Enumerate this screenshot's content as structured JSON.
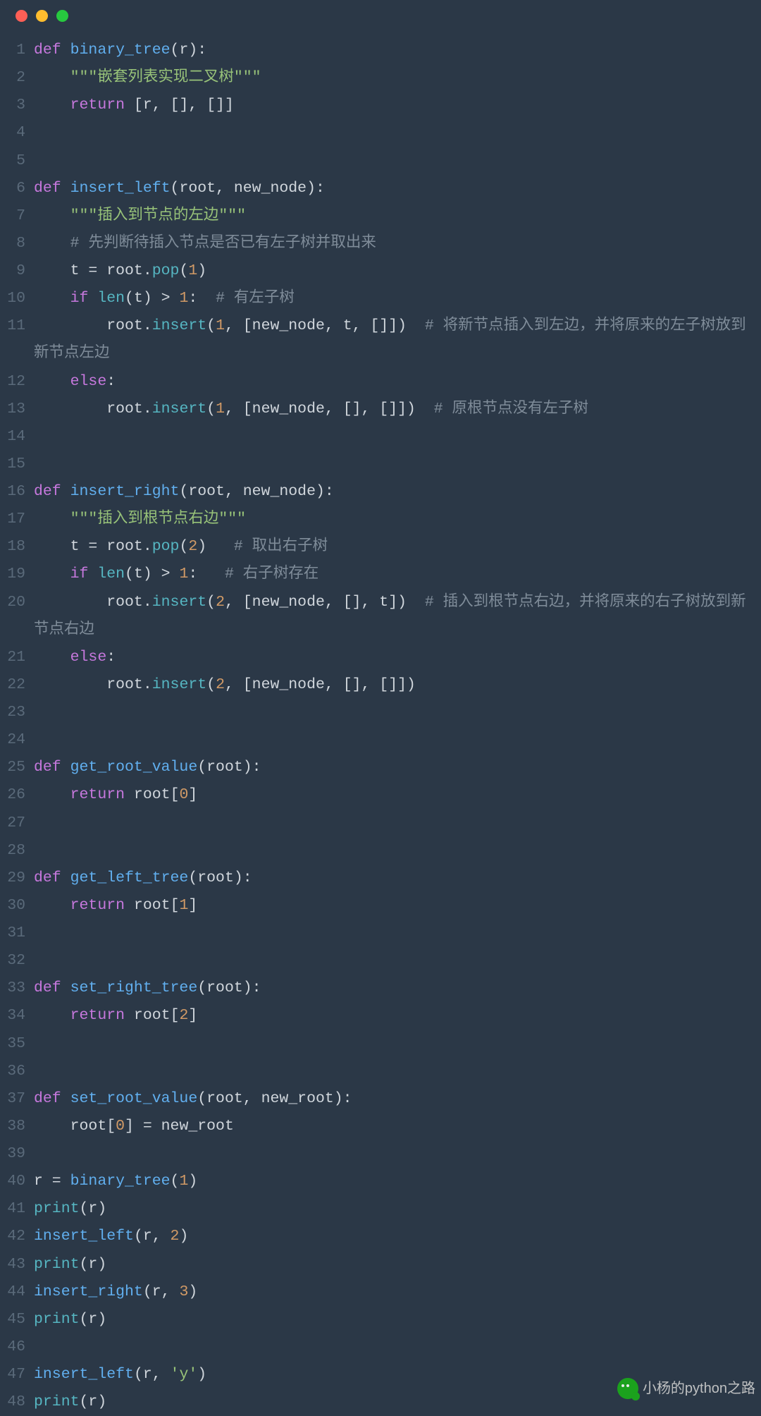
{
  "window": {
    "buttons": [
      "close",
      "minimize",
      "zoom"
    ]
  },
  "watermark": "小杨的python之路",
  "code": {
    "lines": [
      {
        "n": 1,
        "t": [
          [
            "kw",
            "def "
          ],
          [
            "fn",
            "binary_tree"
          ],
          [
            "p",
            "(r):"
          ]
        ]
      },
      {
        "n": 2,
        "t": [
          [
            "p",
            "    "
          ],
          [
            "s",
            "\"\"\"嵌套列表实现二叉树\"\"\""
          ]
        ]
      },
      {
        "n": 3,
        "t": [
          [
            "p",
            "    "
          ],
          [
            "kw",
            "return"
          ],
          [
            "p",
            " [r, [], []]"
          ]
        ]
      },
      {
        "n": 4,
        "t": [
          [
            "p",
            ""
          ]
        ]
      },
      {
        "n": 5,
        "t": [
          [
            "p",
            ""
          ]
        ]
      },
      {
        "n": 6,
        "t": [
          [
            "kw",
            "def "
          ],
          [
            "fn",
            "insert_left"
          ],
          [
            "p",
            "(root, new_node):"
          ]
        ]
      },
      {
        "n": 7,
        "t": [
          [
            "p",
            "    "
          ],
          [
            "s",
            "\"\"\"插入到节点的左边\"\"\""
          ]
        ]
      },
      {
        "n": 8,
        "t": [
          [
            "p",
            "    "
          ],
          [
            "c",
            "# 先判断待插入节点是否已有左子树并取出来"
          ]
        ]
      },
      {
        "n": 9,
        "t": [
          [
            "p",
            "    t = root."
          ],
          [
            "fn2",
            "pop"
          ],
          [
            "p",
            "("
          ],
          [
            "n",
            "1"
          ],
          [
            "p",
            ")"
          ]
        ]
      },
      {
        "n": 10,
        "t": [
          [
            "p",
            "    "
          ],
          [
            "kw",
            "if"
          ],
          [
            "p",
            " "
          ],
          [
            "fn2",
            "len"
          ],
          [
            "p",
            "(t) > "
          ],
          [
            "n",
            "1"
          ],
          [
            "p",
            ":  "
          ],
          [
            "c",
            "# 有左子树"
          ]
        ]
      },
      {
        "n": 11,
        "t": [
          [
            "p",
            "        root."
          ],
          [
            "fn2",
            "insert"
          ],
          [
            "p",
            "("
          ],
          [
            "n",
            "1"
          ],
          [
            "p",
            ", [new_node, t, []])  "
          ],
          [
            "c",
            "# 将新节点插入到左边，并将原来的左子树放到新节点左边"
          ]
        ]
      },
      {
        "n": 12,
        "t": [
          [
            "p",
            "    "
          ],
          [
            "kw",
            "else"
          ],
          [
            "p",
            ":"
          ]
        ]
      },
      {
        "n": 13,
        "t": [
          [
            "p",
            "        root."
          ],
          [
            "fn2",
            "insert"
          ],
          [
            "p",
            "("
          ],
          [
            "n",
            "1"
          ],
          [
            "p",
            ", [new_node, [], []])  "
          ],
          [
            "c",
            "# 原根节点没有左子树"
          ]
        ]
      },
      {
        "n": 14,
        "t": [
          [
            "p",
            ""
          ]
        ]
      },
      {
        "n": 15,
        "t": [
          [
            "p",
            ""
          ]
        ]
      },
      {
        "n": 16,
        "t": [
          [
            "kw",
            "def "
          ],
          [
            "fn",
            "insert_right"
          ],
          [
            "p",
            "(root, new_node):"
          ]
        ]
      },
      {
        "n": 17,
        "t": [
          [
            "p",
            "    "
          ],
          [
            "s",
            "\"\"\"插入到根节点右边\"\"\""
          ]
        ]
      },
      {
        "n": 18,
        "t": [
          [
            "p",
            "    t = root."
          ],
          [
            "fn2",
            "pop"
          ],
          [
            "p",
            "("
          ],
          [
            "n",
            "2"
          ],
          [
            "p",
            ")   "
          ],
          [
            "c",
            "# 取出右子树"
          ]
        ]
      },
      {
        "n": 19,
        "t": [
          [
            "p",
            "    "
          ],
          [
            "kw",
            "if"
          ],
          [
            "p",
            " "
          ],
          [
            "fn2",
            "len"
          ],
          [
            "p",
            "(t) > "
          ],
          [
            "n",
            "1"
          ],
          [
            "p",
            ":   "
          ],
          [
            "c",
            "# 右子树存在"
          ]
        ]
      },
      {
        "n": 20,
        "t": [
          [
            "p",
            "        root."
          ],
          [
            "fn2",
            "insert"
          ],
          [
            "p",
            "("
          ],
          [
            "n",
            "2"
          ],
          [
            "p",
            ", [new_node, [], t])  "
          ],
          [
            "c",
            "# 插入到根节点右边，并将原来的右子树放到新节点右边"
          ]
        ]
      },
      {
        "n": 21,
        "t": [
          [
            "p",
            "    "
          ],
          [
            "kw",
            "else"
          ],
          [
            "p",
            ":"
          ]
        ]
      },
      {
        "n": 22,
        "t": [
          [
            "p",
            "        root."
          ],
          [
            "fn2",
            "insert"
          ],
          [
            "p",
            "("
          ],
          [
            "n",
            "2"
          ],
          [
            "p",
            ", [new_node, [], []])"
          ]
        ]
      },
      {
        "n": 23,
        "t": [
          [
            "p",
            ""
          ]
        ]
      },
      {
        "n": 24,
        "t": [
          [
            "p",
            ""
          ]
        ]
      },
      {
        "n": 25,
        "t": [
          [
            "kw",
            "def "
          ],
          [
            "fn",
            "get_root_value"
          ],
          [
            "p",
            "(root):"
          ]
        ]
      },
      {
        "n": 26,
        "t": [
          [
            "p",
            "    "
          ],
          [
            "kw",
            "return"
          ],
          [
            "p",
            " root["
          ],
          [
            "n",
            "0"
          ],
          [
            "p",
            "]"
          ]
        ]
      },
      {
        "n": 27,
        "t": [
          [
            "p",
            ""
          ]
        ]
      },
      {
        "n": 28,
        "t": [
          [
            "p",
            ""
          ]
        ]
      },
      {
        "n": 29,
        "t": [
          [
            "kw",
            "def "
          ],
          [
            "fn",
            "get_left_tree"
          ],
          [
            "p",
            "(root):"
          ]
        ]
      },
      {
        "n": 30,
        "t": [
          [
            "p",
            "    "
          ],
          [
            "kw",
            "return"
          ],
          [
            "p",
            " root["
          ],
          [
            "n",
            "1"
          ],
          [
            "p",
            "]"
          ]
        ]
      },
      {
        "n": 31,
        "t": [
          [
            "p",
            ""
          ]
        ]
      },
      {
        "n": 32,
        "t": [
          [
            "p",
            ""
          ]
        ]
      },
      {
        "n": 33,
        "t": [
          [
            "kw",
            "def "
          ],
          [
            "fn",
            "set_right_tree"
          ],
          [
            "p",
            "(root):"
          ]
        ]
      },
      {
        "n": 34,
        "t": [
          [
            "p",
            "    "
          ],
          [
            "kw",
            "return"
          ],
          [
            "p",
            " root["
          ],
          [
            "n",
            "2"
          ],
          [
            "p",
            "]"
          ]
        ]
      },
      {
        "n": 35,
        "t": [
          [
            "p",
            ""
          ]
        ]
      },
      {
        "n": 36,
        "t": [
          [
            "p",
            ""
          ]
        ]
      },
      {
        "n": 37,
        "t": [
          [
            "kw",
            "def "
          ],
          [
            "fn",
            "set_root_value"
          ],
          [
            "p",
            "(root, new_root):"
          ]
        ]
      },
      {
        "n": 38,
        "t": [
          [
            "p",
            "    root["
          ],
          [
            "n",
            "0"
          ],
          [
            "p",
            "] = new_root"
          ]
        ]
      },
      {
        "n": 39,
        "t": [
          [
            "p",
            ""
          ]
        ]
      },
      {
        "n": 40,
        "t": [
          [
            "p",
            "r = "
          ],
          [
            "fn",
            "binary_tree"
          ],
          [
            "p",
            "("
          ],
          [
            "n",
            "1"
          ],
          [
            "p",
            ")"
          ]
        ]
      },
      {
        "n": 41,
        "t": [
          [
            "fn2",
            "print"
          ],
          [
            "p",
            "(r)"
          ]
        ]
      },
      {
        "n": 42,
        "t": [
          [
            "fn",
            "insert_left"
          ],
          [
            "p",
            "(r, "
          ],
          [
            "n",
            "2"
          ],
          [
            "p",
            ")"
          ]
        ]
      },
      {
        "n": 43,
        "t": [
          [
            "fn2",
            "print"
          ],
          [
            "p",
            "(r)"
          ]
        ]
      },
      {
        "n": 44,
        "t": [
          [
            "fn",
            "insert_right"
          ],
          [
            "p",
            "(r, "
          ],
          [
            "n",
            "3"
          ],
          [
            "p",
            ")"
          ]
        ]
      },
      {
        "n": 45,
        "t": [
          [
            "fn2",
            "print"
          ],
          [
            "p",
            "(r)"
          ]
        ]
      },
      {
        "n": 46,
        "t": [
          [
            "p",
            ""
          ]
        ]
      },
      {
        "n": 47,
        "t": [
          [
            "fn",
            "insert_left"
          ],
          [
            "p",
            "(r, "
          ],
          [
            "s",
            "'y'"
          ],
          [
            "p",
            ")"
          ]
        ]
      },
      {
        "n": 48,
        "t": [
          [
            "fn2",
            "print"
          ],
          [
            "p",
            "(r)"
          ]
        ]
      }
    ]
  }
}
